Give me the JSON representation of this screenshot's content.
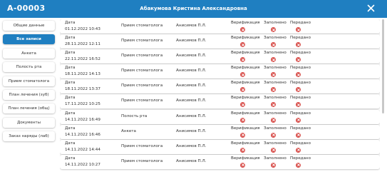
{
  "header": {
    "record_code": "A-00003",
    "patient_name": "Абакумова Кристина Александровна",
    "background_color": "#1f7fc1"
  },
  "sidebar": {
    "items": [
      {
        "label": "Общие данные",
        "active": false
      },
      {
        "label": "Все записи",
        "active": true
      },
      {
        "label": "Анкета",
        "active": false
      },
      {
        "label": "Полость рта",
        "active": false
      },
      {
        "label": "Прием стоматолога",
        "active": false
      },
      {
        "label": "План лечения (зуб)",
        "active": false
      },
      {
        "label": "План лечения (общ)",
        "active": false
      },
      {
        "label": "Документы",
        "active": false
      },
      {
        "label": "Заказ наряды (лаб)",
        "active": false
      }
    ]
  },
  "records": {
    "date_label": "Дата",
    "status_labels": {
      "verification": "Верификация",
      "filled": "Заполнено",
      "sent": "Передано"
    },
    "status_icon": "x-circle-icon",
    "status_color": "#d9534f",
    "rows": [
      {
        "date": "01.12.2022 10:43",
        "type": "Прием стоматолога",
        "doctor": "Анисимов П.Л."
      },
      {
        "date": "28.11.2022 12:11",
        "type": "Прием стоматолога",
        "doctor": "Анисимов П.Л."
      },
      {
        "date": "22.11.2022 16:52",
        "type": "Прием стоматолога",
        "doctor": "Анисимов П.Л."
      },
      {
        "date": "18.11.2022 14:13",
        "type": "Прием стоматолога",
        "doctor": "Анисимов П.Л."
      },
      {
        "date": "18.11.2022 13:37",
        "type": "Прием стоматолога",
        "doctor": "Анисимов П.Л."
      },
      {
        "date": "17.11.2022 10:25",
        "type": "Прием стоматолога",
        "doctor": "Анисимов П.Л."
      },
      {
        "date": "14.11.2022 16:49",
        "type": "Полость рта",
        "doctor": "Анисимов П.Л."
      },
      {
        "date": "14.11.2022 16:46",
        "type": "Анкета",
        "doctor": "Анисимов П.Л."
      },
      {
        "date": "14.11.2022 14:44",
        "type": "Прием стоматолога",
        "doctor": "Анисимов П.Л."
      },
      {
        "date": "14.11.2022 10:27",
        "type": "Прием стоматолога",
        "doctor": "Анисимов П.Л."
      }
    ]
  }
}
